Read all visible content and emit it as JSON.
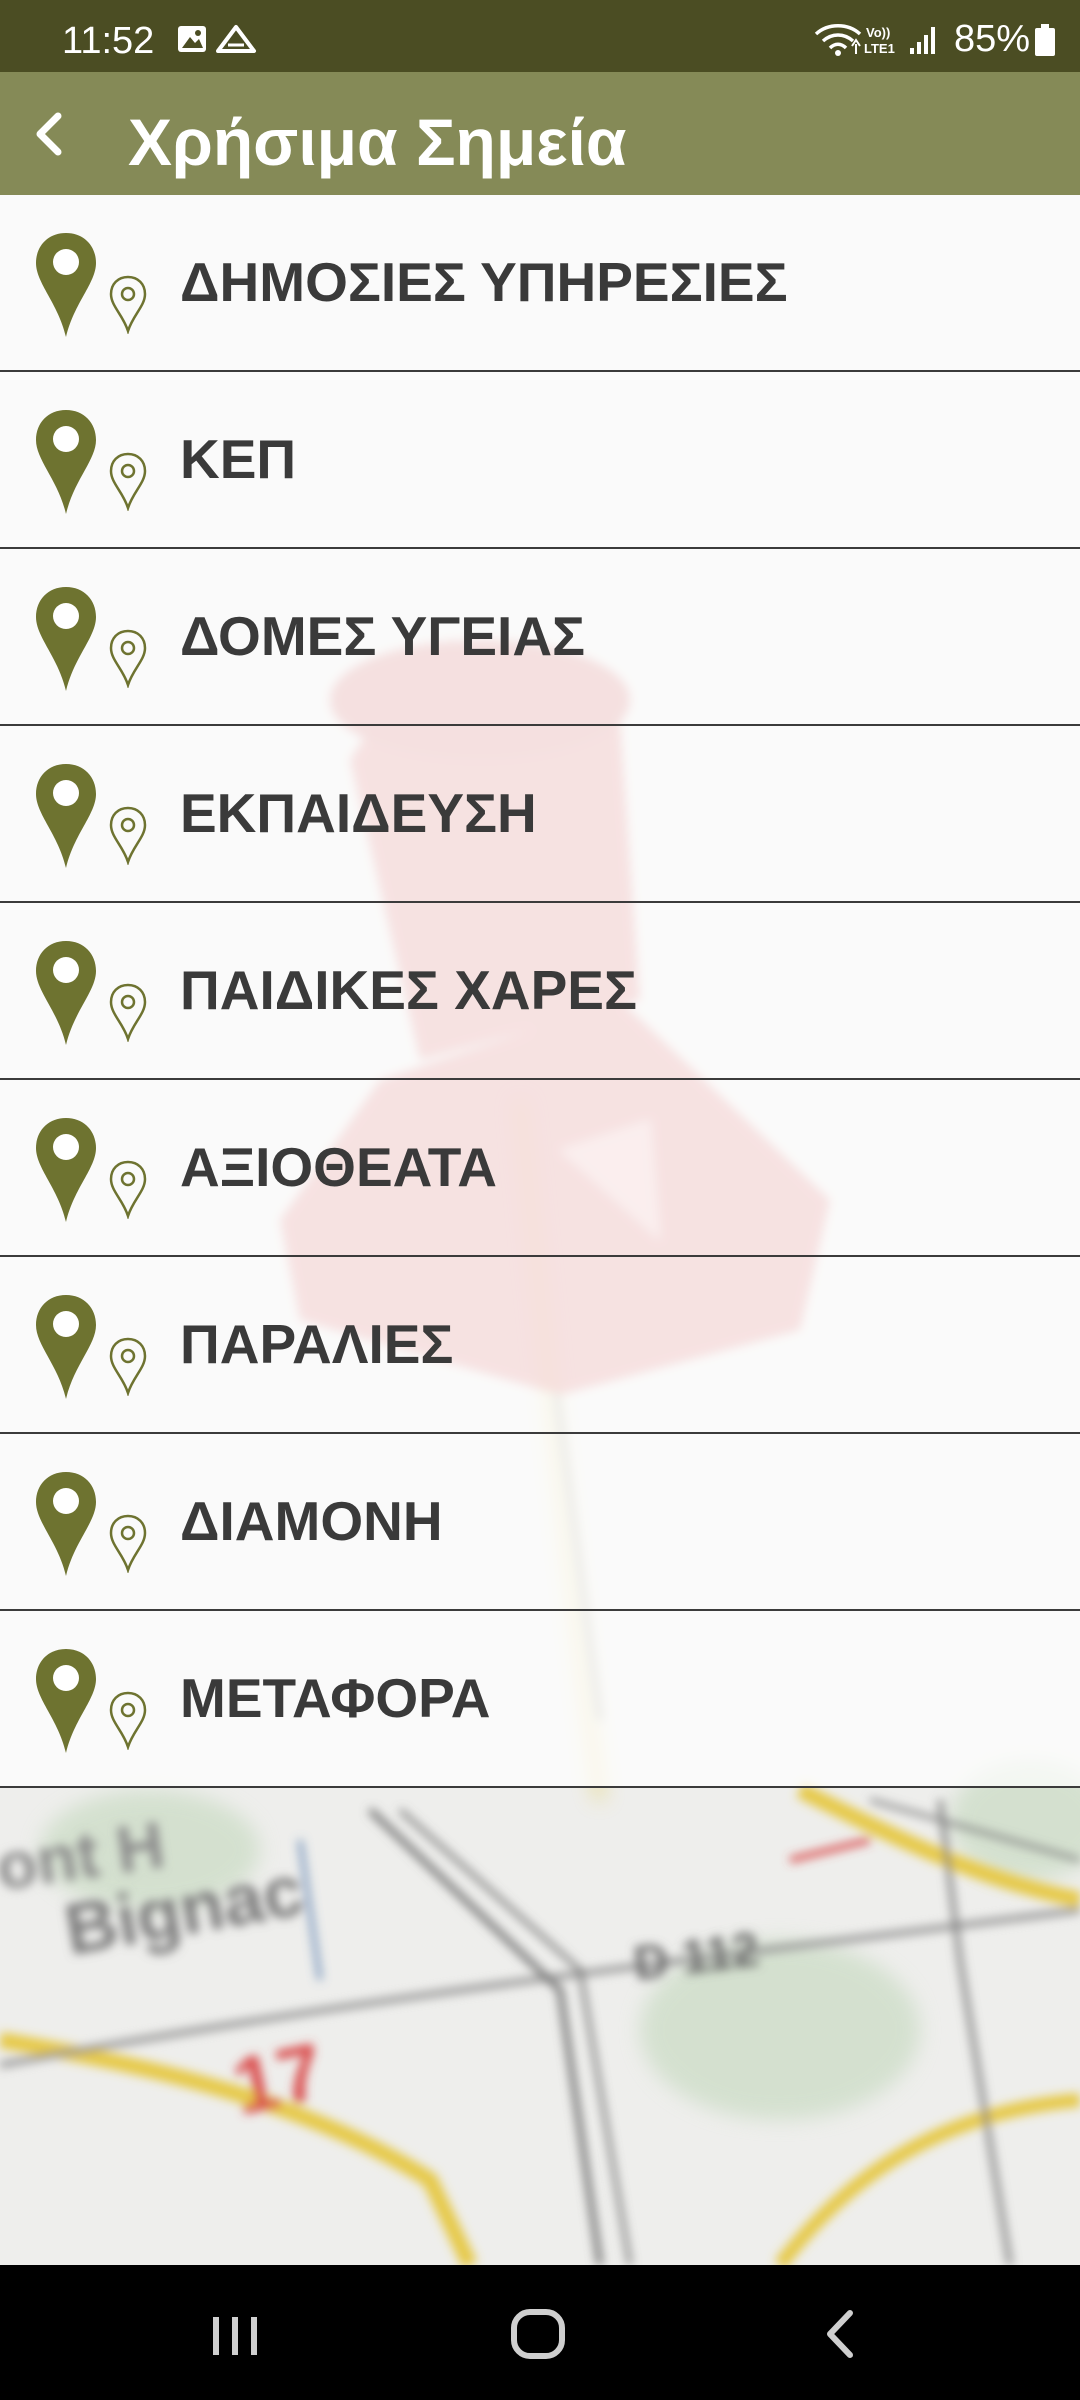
{
  "status_bar": {
    "time": "11:52",
    "left_icons": [
      "gallery-icon",
      "drive-icon"
    ],
    "right_icons": [
      "wifi-icon",
      "volte-lte-icon",
      "signal-icon"
    ],
    "battery_percent": "85%"
  },
  "app_bar": {
    "title": "Χρήσιμα Σημεία",
    "back_icon": "back-arrow-icon"
  },
  "categories": [
    {
      "label": "ΔΗΜΟΣΙΕΣ ΥΠΗΡΕΣΙΕΣ"
    },
    {
      "label": "ΚΕΠ"
    },
    {
      "label": "ΔΟΜΕΣ ΥΓΕΙΑΣ"
    },
    {
      "label": "ΕΚΠΑΙΔΕΥΣΗ"
    },
    {
      "label": "ΠΑΙΔΙΚΕΣ ΧΑΡΕΣ"
    },
    {
      "label": "ΑΞΙΟΘΕΑΤΑ"
    },
    {
      "label": "ΠΑΡΑΛΙΕΣ"
    },
    {
      "label": "ΔΙΑΜΟΝΗ"
    },
    {
      "label": "ΜΕΤΑΦΟΡΑ"
    }
  ],
  "background_map_text": {
    "place": "Bignac",
    "place_partial": "ont H",
    "road": "D 112",
    "road_number": "17"
  },
  "colors": {
    "status_bar": "#4b4d23",
    "app_bar": "#858a57",
    "pin": "#6e7330",
    "text": "#3a3a3a",
    "divider": "#3b3b3b"
  },
  "nav_bar": {
    "buttons": [
      "recents-icon",
      "home-icon",
      "back-icon"
    ]
  }
}
